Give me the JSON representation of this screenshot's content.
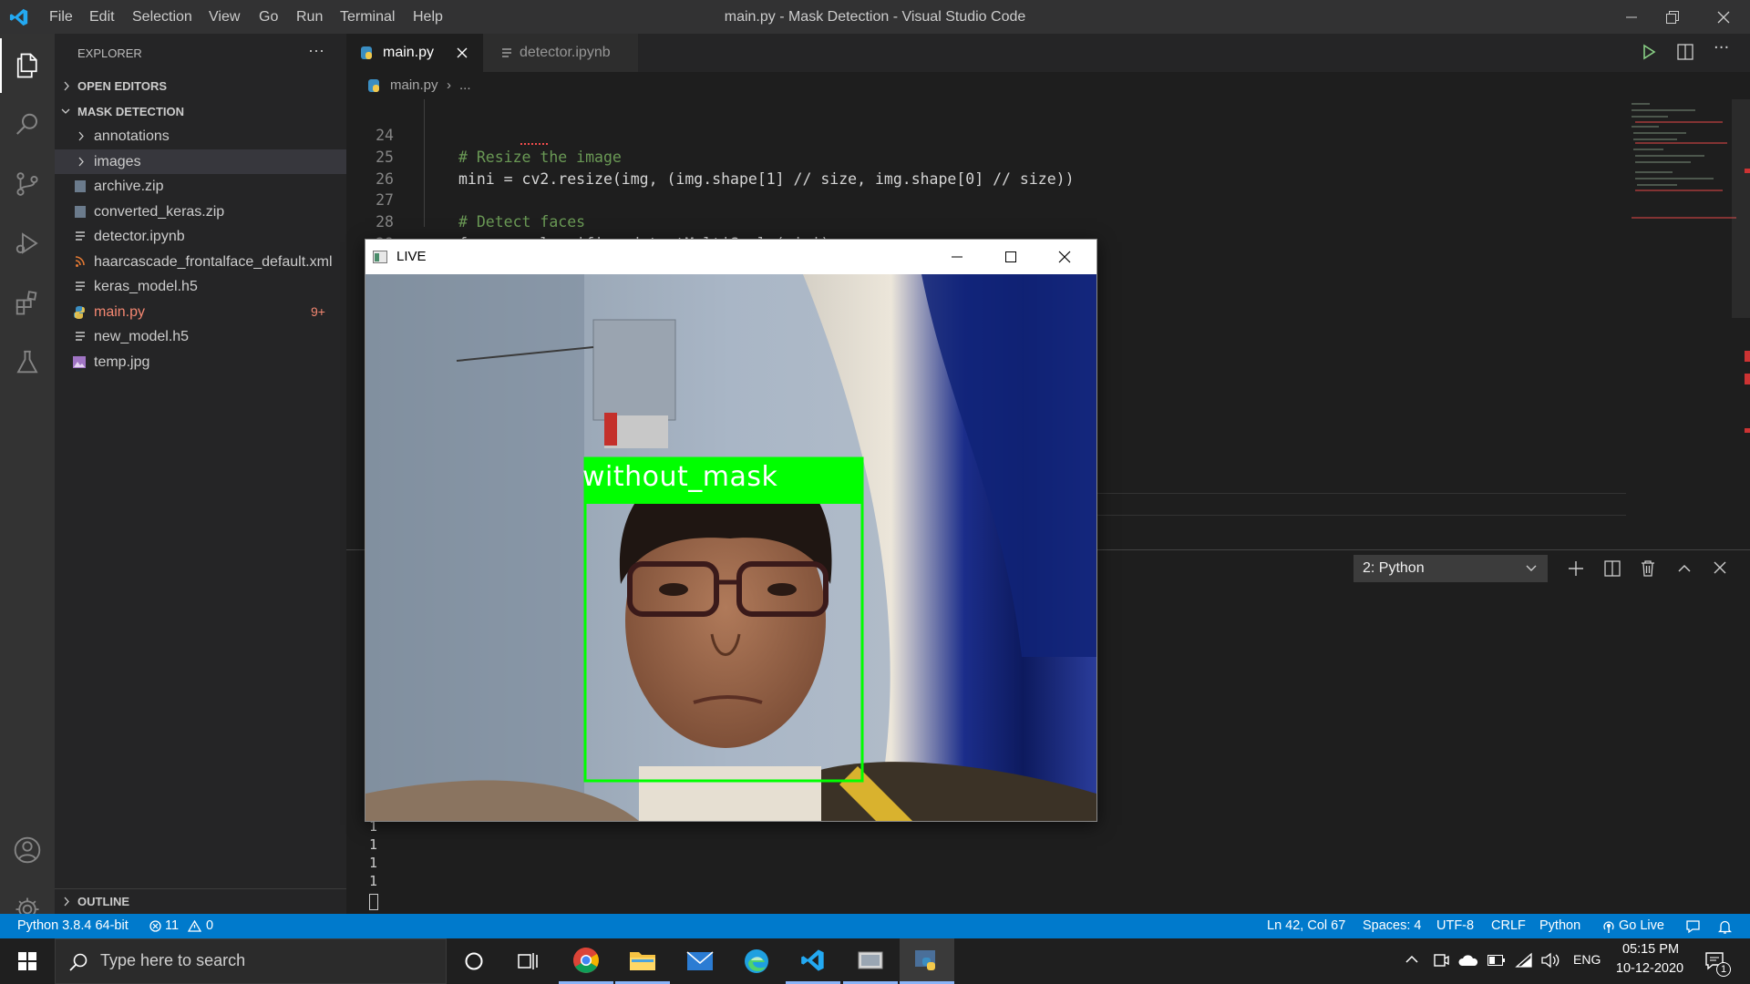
{
  "window": {
    "title": "main.py - Mask Detection - Visual Studio Code",
    "menu": [
      "File",
      "Edit",
      "Selection",
      "View",
      "Go",
      "Run",
      "Terminal",
      "Help"
    ]
  },
  "sidebar": {
    "header": "EXPLORER",
    "more": "···",
    "open_editors": "OPEN EDITORS",
    "folder": "MASK DETECTION",
    "items": [
      {
        "label": "annotations",
        "type": "folder"
      },
      {
        "label": "images",
        "type": "folder",
        "selected": true
      },
      {
        "label": "archive.zip",
        "type": "zip"
      },
      {
        "label": "converted_keras.zip",
        "type": "zip"
      },
      {
        "label": "detector.ipynb",
        "type": "notebook"
      },
      {
        "label": "haarcascade_frontalface_default.xml",
        "type": "xml"
      },
      {
        "label": "keras_model.h5",
        "type": "h5"
      },
      {
        "label": "main.py",
        "type": "python",
        "badge": "9+",
        "modified": true
      },
      {
        "label": "new_model.h5",
        "type": "h5"
      },
      {
        "label": "temp.jpg",
        "type": "image"
      }
    ],
    "outline": "OUTLINE"
  },
  "tabs": [
    {
      "label": "main.py",
      "active": true
    },
    {
      "label": "detector.ipynb",
      "active": false
    }
  ],
  "breadcrumb": {
    "file": "main.py",
    "rest": "..."
  },
  "code": [
    {
      "ln": "24",
      "text": "# Resize the image",
      "comment": true
    },
    {
      "ln": "25",
      "text": "mini = cv2.resize(img, (img.shape[1] // size, img.shape[0] // size))",
      "comment": false
    },
    {
      "ln": "26",
      "text": "",
      "comment": false
    },
    {
      "ln": "27",
      "text": "# Detect faces",
      "comment": true
    },
    {
      "ln": "28",
      "text": "faces = classifier.detectMultiScale(mini)",
      "comment": false
    },
    {
      "ln": "29",
      "text": "",
      "comment": false
    }
  ],
  "panel": {
    "terminal_select": "2: Python",
    "output": [
      "1",
      "1",
      "1",
      "1"
    ]
  },
  "live_window": {
    "title": "LIVE",
    "detection_label": "without_mask",
    "box_color": "#00ff00"
  },
  "statusbar": {
    "interpreter": "Python 3.8.4 64-bit",
    "errors": "11",
    "warnings": "0",
    "position": "Ln 42, Col 67",
    "spaces": "Spaces: 4",
    "encoding": "UTF-8",
    "eol": "CRLF",
    "language": "Python",
    "golive": "Go Live"
  },
  "taskbar": {
    "search_placeholder": "Type here to search",
    "lang": "ENG",
    "time": "05:15 PM",
    "date": "10-12-2020",
    "notifications": "1"
  },
  "colors": {
    "accent": "#007acc",
    "modified": "#f48771",
    "comment": "#6a9955"
  }
}
